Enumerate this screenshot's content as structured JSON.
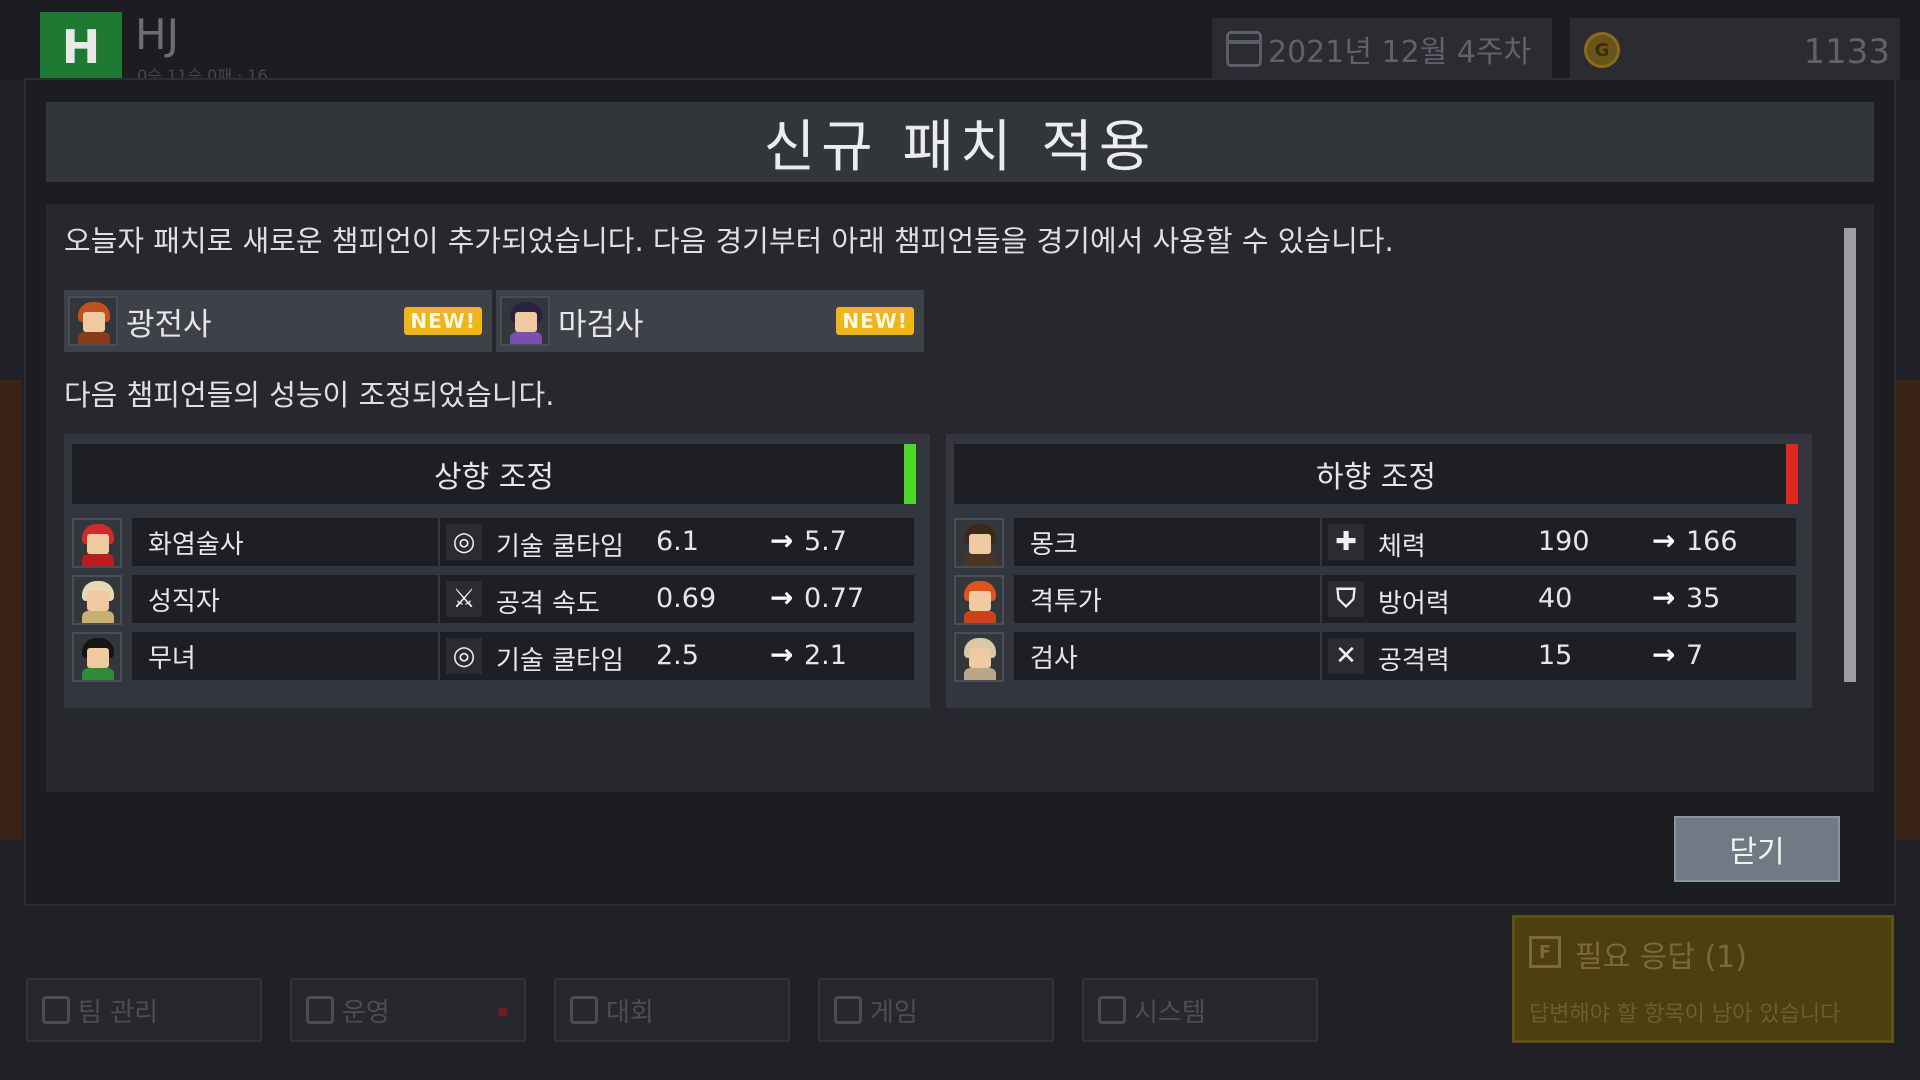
{
  "header": {
    "team_logo": "H",
    "team_name": "HJ",
    "team_record": "0승 11승 0패 · 16",
    "date": "2021년 12월 4주차",
    "gold": "1133"
  },
  "modal": {
    "title": "신규 패치 적용",
    "intro": "오늘자 패치로 새로운 챔피언이 추가되었습니다. 다음 경기부터 아래 챔피언들을 경기에서 사용할 수 있습니다.",
    "new_champions": [
      {
        "name": "광전사",
        "badge": "NEW!"
      },
      {
        "name": "마검사",
        "badge": "NEW!"
      }
    ],
    "adjust_intro": "다음 챔피언들의 성능이 조정되었습니다.",
    "buff": {
      "title": "상향 조정",
      "color": "#4cd62a",
      "rows": [
        {
          "name": "화염술사",
          "icon": "cooldown-icon",
          "stat": "기술 쿨타임",
          "old": "6.1",
          "new": "5.7"
        },
        {
          "name": "성직자",
          "icon": "attack-speed-icon",
          "stat": "공격 속도",
          "old": "0.69",
          "new": "0.77"
        },
        {
          "name": "무녀",
          "icon": "cooldown-icon",
          "stat": "기술 쿨타임",
          "old": "2.5",
          "new": "2.1"
        }
      ]
    },
    "nerf": {
      "title": "하향 조정",
      "color": "#e0281c",
      "rows": [
        {
          "name": "몽크",
          "icon": "health-icon",
          "stat": "체력",
          "old": "190",
          "new": "166"
        },
        {
          "name": "격투가",
          "icon": "defense-icon",
          "stat": "방어력",
          "old": "40",
          "new": "35"
        },
        {
          "name": "검사",
          "icon": "attack-icon",
          "stat": "공격력",
          "old": "15",
          "new": "7"
        }
      ]
    },
    "close_label": "닫기"
  },
  "bottom_nav": [
    {
      "label": "팀 관리",
      "icon": "shield-icon"
    },
    {
      "label": "운영",
      "icon": "document-icon"
    },
    {
      "label": "대회",
      "icon": "trophy-icon"
    },
    {
      "label": "게임",
      "icon": "gamepad-icon"
    },
    {
      "label": "시스템",
      "icon": "gear-icon"
    }
  ],
  "alert": {
    "key": "F",
    "title": "필요 응답 (1)",
    "subtitle": "답변해야 할 항목이 남아 있습니다"
  }
}
